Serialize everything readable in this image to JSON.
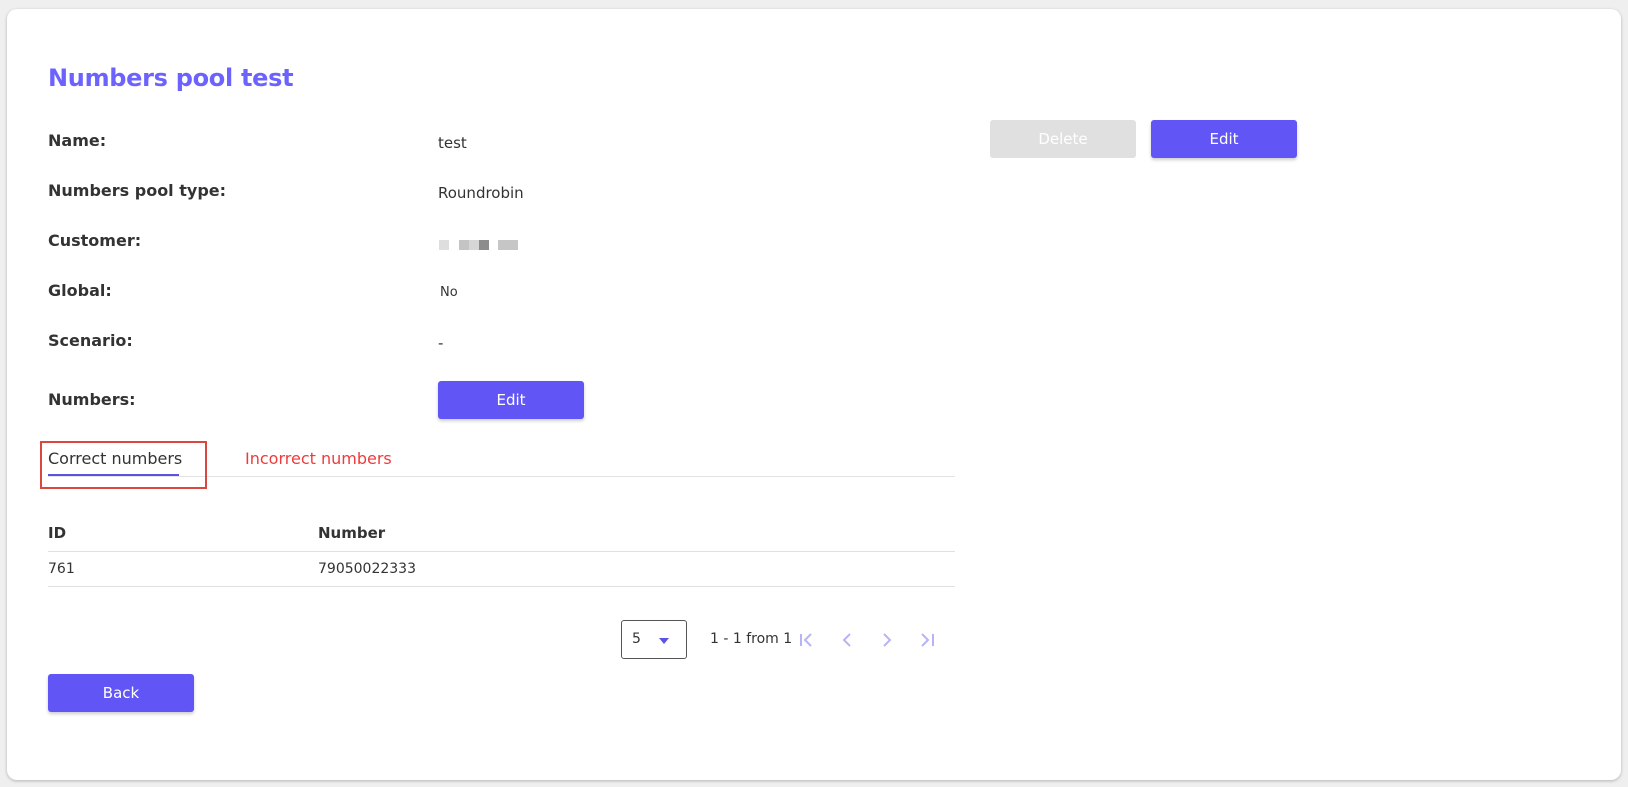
{
  "page": {
    "title": "Numbers pool test"
  },
  "details": {
    "name_label": "Name:",
    "name_value": "test",
    "type_label": "Numbers pool type:",
    "type_value": "Roundrobin",
    "customer_label": "Customer:",
    "global_label": "Global:",
    "global_value": "No",
    "scenario_label": "Scenario:",
    "scenario_value": "-",
    "numbers_label": "Numbers:",
    "numbers_edit_label": "Edit"
  },
  "actions": {
    "delete_label": "Delete",
    "edit_label": "Edit",
    "back_label": "Back"
  },
  "tabs": {
    "correct_label": "Correct numbers",
    "incorrect_label": "Incorrect numbers"
  },
  "table": {
    "columns": [
      "ID",
      "Number"
    ],
    "rows": [
      [
        "761",
        "79050022333"
      ]
    ]
  },
  "pagination": {
    "page_size": "5",
    "range_text": "1 - 1 from 1"
  },
  "icons": {
    "first": "first-page-icon",
    "prev": "chevron-left-icon",
    "next": "chevron-right-icon",
    "last": "last-page-icon",
    "dropdown": "caret-down-icon"
  },
  "colors": {
    "accent": "#6155f5",
    "title": "#6c63ff",
    "danger": "#ef3b3b",
    "disabled": "#e0e0e0",
    "pager_icon": "#b7b4f5"
  }
}
